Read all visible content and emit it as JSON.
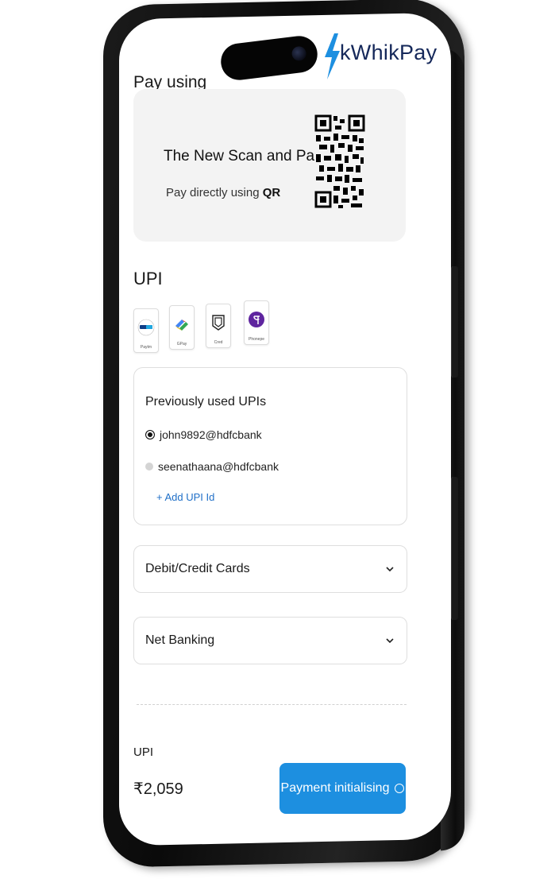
{
  "brand": {
    "name": "kWhikPay",
    "accent": "#1d8fe0",
    "navy": "#15285a"
  },
  "header": {
    "title": "Pay using"
  },
  "qr_card": {
    "title": "The New Scan and Pay",
    "subtitle_prefix": "Pay directly using ",
    "subtitle_bold": "QR",
    "icon": "qr-code-icon"
  },
  "upi": {
    "heading": "UPI",
    "apps": [
      {
        "name": "Paytm",
        "icon": "paytm-icon"
      },
      {
        "name": "GPay",
        "icon": "gpay-icon"
      },
      {
        "name": "Cred",
        "icon": "cred-icon"
      },
      {
        "name": "Phonepe",
        "icon": "phonepe-icon"
      }
    ],
    "previous": {
      "title": "Previously used UPIs",
      "items": [
        {
          "id": "john9892@hdfcbank",
          "selected": true
        },
        {
          "id": "seenathaana@hdfcbank",
          "selected": false
        }
      ],
      "add_label": "+ Add UPI Id"
    }
  },
  "accordions": [
    {
      "label": "Debit/Credit Cards",
      "icon": "chevron-down-icon"
    },
    {
      "label": "Net Banking",
      "icon": "chevron-down-icon"
    }
  ],
  "footer": {
    "method": "UPI",
    "amount": "₹2,059",
    "button_label": "Payment initialising",
    "button_icon": "spinner-icon"
  }
}
